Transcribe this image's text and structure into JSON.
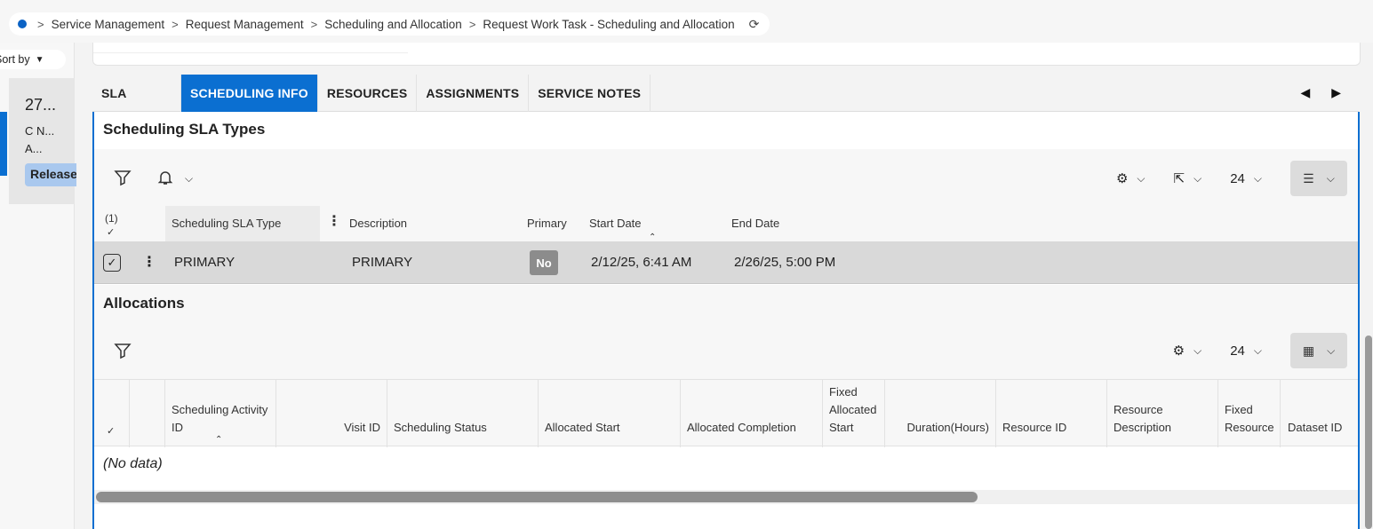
{
  "breadcrumb": {
    "items": [
      "Service Management",
      "Request Management",
      "Scheduling and Allocation",
      "Request Work Task - Scheduling and Allocation"
    ]
  },
  "left_panel": {
    "sort_label": "Sort by",
    "card": {
      "line1": "27...",
      "line2": "C N...",
      "line3": "A...",
      "status": "Released"
    }
  },
  "tabs": [
    {
      "label": "SLA",
      "active": false
    },
    {
      "label": "SCHEDULING INFO",
      "active": true
    },
    {
      "label": "RESOURCES",
      "active": false
    },
    {
      "label": "ASSIGNMENTS",
      "active": false
    },
    {
      "label": "SERVICE NOTES",
      "active": false
    }
  ],
  "sla_types": {
    "title": "Scheduling SLA Types",
    "page_size": "24",
    "selected_count": "(1)",
    "columns": [
      "Scheduling SLA Type",
      "Description",
      "Primary",
      "Start Date",
      "End Date"
    ],
    "rows": [
      {
        "type": "PRIMARY",
        "description": "PRIMARY",
        "primary": "No",
        "start": "2/12/25, 6:41 AM",
        "end": "2/26/25, 5:00 PM"
      }
    ]
  },
  "allocations": {
    "title": "Allocations",
    "page_size": "24",
    "columns": {
      "activity": "Scheduling Activity ID",
      "visit": "Visit ID",
      "status": "Scheduling Status",
      "alloc_start": "Allocated Start",
      "alloc_completion": "Allocated Completion",
      "fixed_alloc_start": "Fixed Allocated Start",
      "duration": "Duration(Hours)",
      "resource_id": "Resource ID",
      "resource_desc": "Resource Description",
      "fixed_resource": "Fixed Resource",
      "dataset": "Dataset ID"
    },
    "empty_text": "(No data)"
  },
  "icons": {
    "filter": "filter-icon",
    "bell": "bell-icon",
    "gear": "gear-icon",
    "export": "export-icon",
    "view_list": "list-view-icon",
    "view_table": "table-view-icon"
  },
  "colors": {
    "accent": "#0b6fd1",
    "badge": "#8c8c8c",
    "selected_row": "#d9d9d9"
  }
}
